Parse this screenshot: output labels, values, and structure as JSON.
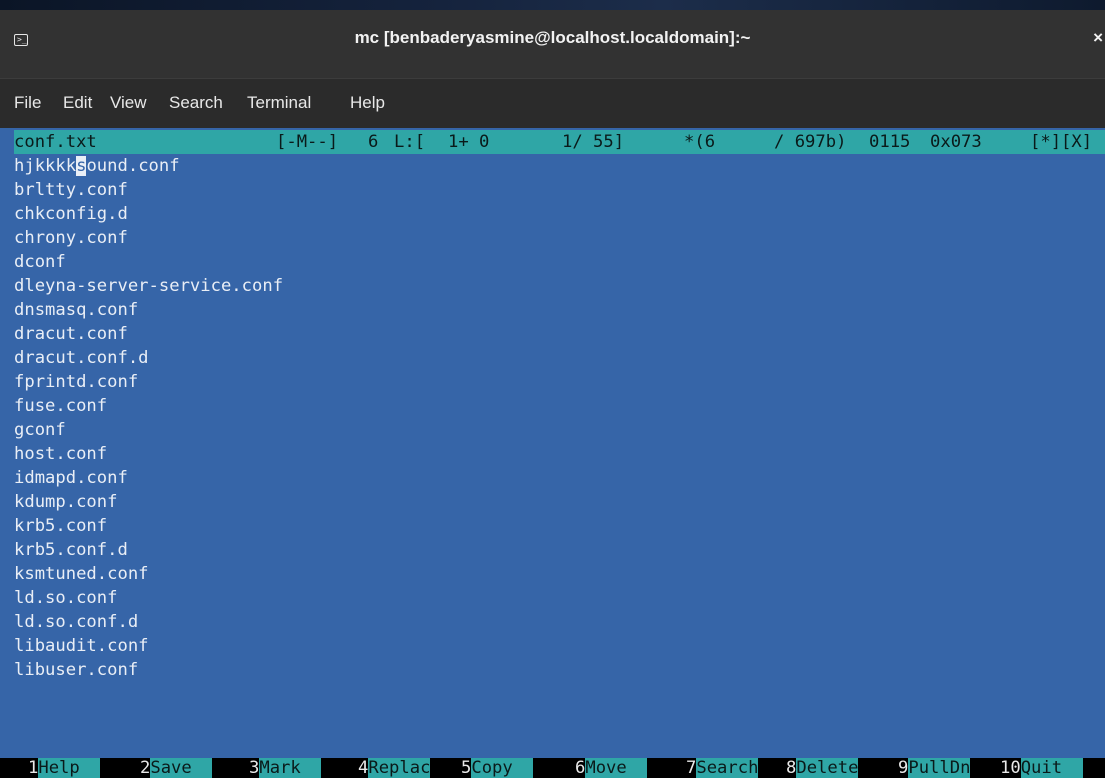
{
  "window": {
    "title": "mc [benbaderyasmine@localhost.localdomain]:~",
    "close_glyph": "×"
  },
  "menu": [
    "File",
    "Edit",
    "View",
    "Search",
    "Terminal",
    "Help"
  ],
  "status": {
    "filename": "conf.txt",
    "mode": "[-M--]",
    "column": "6",
    "line_label": "L:[",
    "line_pos": "1+ 0",
    "line_count": "1/ 55]",
    "offset": "*(6",
    "size": "/ 697b)",
    "char_dec": "0115",
    "char_hex": "0x073",
    "flags": "[*][X]"
  },
  "editor": {
    "cursor_line_prefix": "hjkkkk",
    "cursor_char": "s",
    "cursor_line_suffix": "ound.conf",
    "lines": [
      "brltty.conf",
      "chkconfig.d",
      "chrony.conf",
      "dconf",
      "dleyna-server-service.conf",
      "dnsmasq.conf",
      "dracut.conf",
      "dracut.conf.d",
      "fprintd.conf",
      "fuse.conf",
      "gconf",
      "host.conf",
      "idmapd.conf",
      "kdump.conf",
      "krb5.conf",
      "krb5.conf.d",
      "ksmtuned.conf",
      "ld.so.conf",
      "ld.so.conf.d",
      "libaudit.conf",
      "libuser.conf"
    ]
  },
  "fkeys": [
    {
      "num": "1",
      "label": "Help  "
    },
    {
      "num": "2",
      "label": "Save  "
    },
    {
      "num": "3",
      "label": "Mark  "
    },
    {
      "num": "4",
      "label": "Replac"
    },
    {
      "num": "5",
      "label": "Copy  "
    },
    {
      "num": "6",
      "label": "Move  "
    },
    {
      "num": "7",
      "label": "Search"
    },
    {
      "num": "8",
      "label": "Delete"
    },
    {
      "num": "9",
      "label": "PullDn"
    },
    {
      "num": "10",
      "label": "Quit  "
    }
  ]
}
